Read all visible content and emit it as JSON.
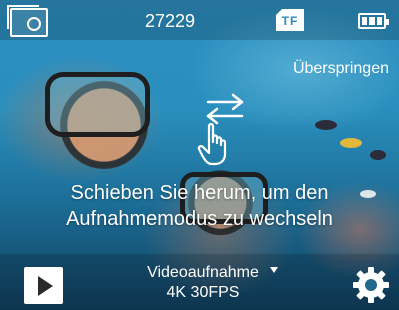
{
  "status_bar": {
    "count": "27229",
    "storage_label": "TF"
  },
  "main": {
    "skip_label": "Überspringen",
    "hint_line1": "Schieben Sie herum, um den",
    "hint_line2": "Aufnahmemodus zu wechseln"
  },
  "bottom_bar": {
    "mode_name": "Videoaufnahme",
    "mode_setting": "4K 30FPS"
  },
  "icons": {
    "gallery": "gallery-icon",
    "storage": "sd-card-icon",
    "battery": "battery-full-icon",
    "swap": "swap-arrows-icon",
    "gesture": "hand-swipe-icon",
    "playback": "play-icon",
    "settings": "gear-icon"
  },
  "colors": {
    "accent": "#2d8ab8",
    "text": "#ffffff"
  }
}
